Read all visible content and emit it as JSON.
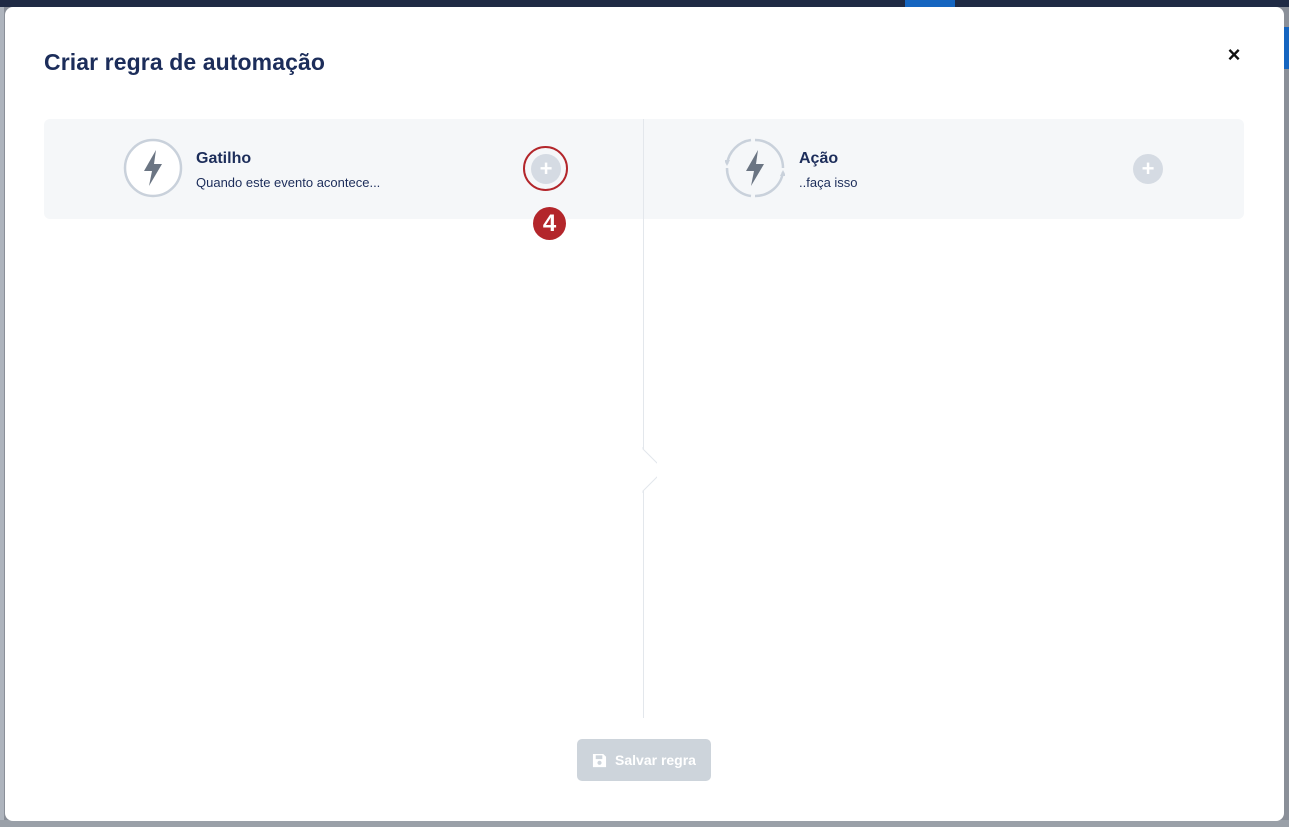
{
  "modal": {
    "title": "Criar regra de automação",
    "close_label": "×"
  },
  "trigger": {
    "title": "Gatilho",
    "subtitle": "Quando este evento acontece...",
    "icon": "lightning-icon"
  },
  "action": {
    "title": "Ação",
    "subtitle": "..faça isso",
    "icon": "lightning-refresh-icon"
  },
  "annotation": {
    "step_number": "4"
  },
  "footer": {
    "save_label": "Salvar regra"
  },
  "colors": {
    "title": "#1c2d5a",
    "panel_bg": "#f5f7f9",
    "add_button": "#d5dbe3",
    "highlight": "#b3262b",
    "save_button_disabled": "#cdd4db"
  }
}
